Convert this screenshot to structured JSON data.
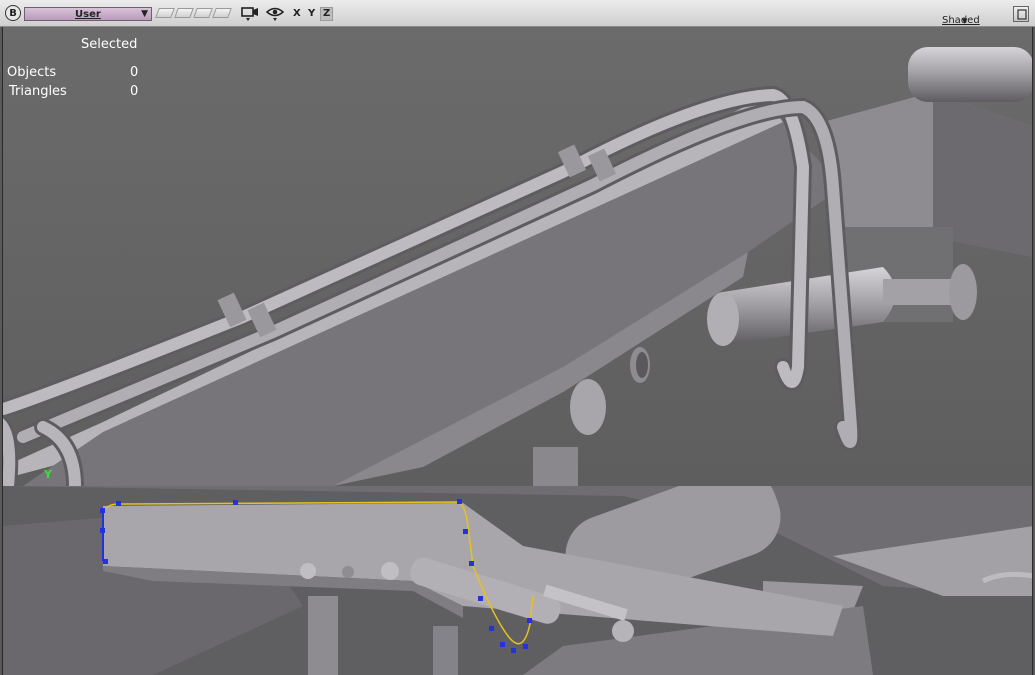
{
  "toolbar": {
    "menu_letter": "B",
    "camera": "User",
    "axes": [
      "X",
      "Y",
      "Z"
    ],
    "shading": "Shaded",
    "icons": {
      "camera": "camera-icon",
      "visibility": "eye-icon",
      "maximize": "maximize-icon"
    }
  },
  "hud": {
    "selected_label": "Selected",
    "objects_label": "Objects",
    "objects_value": "0",
    "triangles_label": "Triangles",
    "triangles_value": "0",
    "axis_label": "Y"
  },
  "colors": {
    "viewport_bg": "#636363",
    "surface": "#9c9a9e",
    "surface_light": "#bab8bc",
    "surface_dark": "#6e6c70",
    "curve": "#e8c21a",
    "curve_blue": "#2233dd",
    "axis_green": "#39e039"
  }
}
